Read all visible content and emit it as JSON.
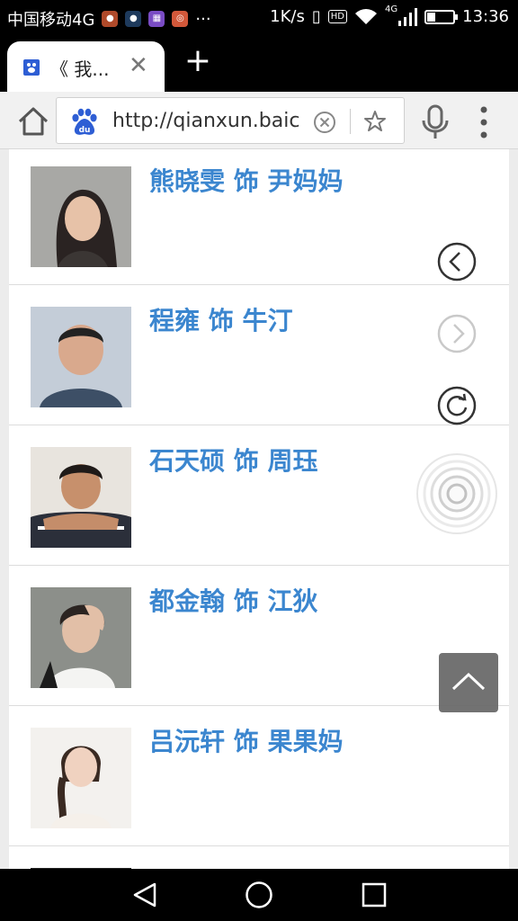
{
  "status_bar": {
    "carrier": "中国移动4G",
    "more": "···",
    "speed": "1K/s",
    "hd_badge": "HD",
    "network_type": "4G",
    "battery_level": 0.3,
    "time": "13:36"
  },
  "tabs": [
    {
      "title": "《 我...",
      "favicon": "baidu-favicon-icon"
    }
  ],
  "new_tab_label": "+",
  "address_bar": {
    "url": "http://qianxun.baic"
  },
  "cast": [
    {
      "name": "熊晓雯 饰 尹妈妈"
    },
    {
      "name": "程雍 饰 牛汀"
    },
    {
      "name": "石天硕 饰 周珏"
    },
    {
      "name": "都金翰 饰 江狄"
    },
    {
      "name": "吕沅轩 饰 果果妈"
    }
  ],
  "colors": {
    "link_blue": "#3b86cf",
    "toolbar_bg": "#f1f1f1",
    "baidu_blue": "#2e5ed4"
  },
  "floating_controls": [
    "back-arrow-icon",
    "forward-arrow-icon",
    "refresh-icon",
    "gesture-icon",
    "scroll-to-top-icon"
  ],
  "nav_bar": [
    "back-nav-icon",
    "home-nav-icon",
    "recents-nav-icon"
  ]
}
